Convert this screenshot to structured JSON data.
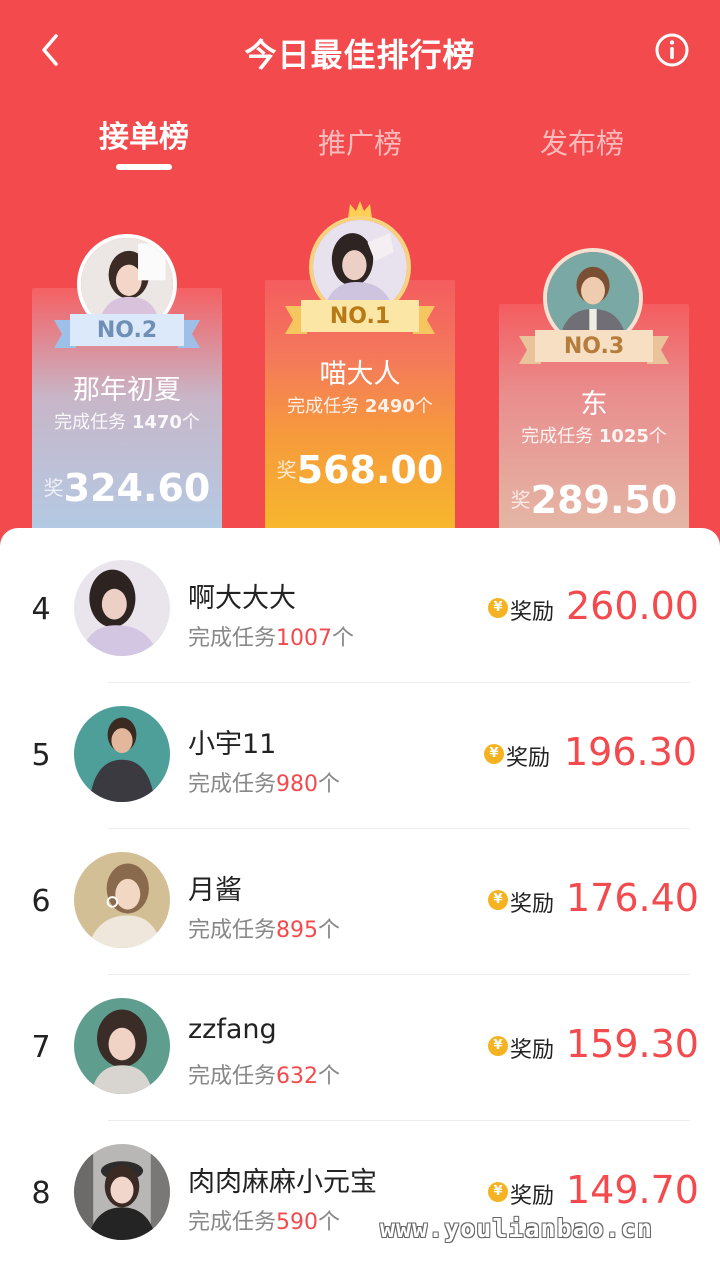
{
  "header": {
    "title": "今日最佳排行榜"
  },
  "tabs": [
    {
      "label": "接单榜"
    },
    {
      "label": "推广榜"
    },
    {
      "label": "发布榜"
    }
  ],
  "podium": {
    "second": {
      "badge": "NO.2",
      "name": "那年初夏",
      "tasks_prefix": "完成任务",
      "tasks": "1470",
      "tasks_suffix": "个",
      "reward_prefix": "奖",
      "reward": "324.60"
    },
    "first": {
      "badge": "NO.1",
      "name": "喵大人",
      "tasks_prefix": "完成任务",
      "tasks": "2490",
      "tasks_suffix": "个",
      "reward_prefix": "奖",
      "reward": "568.00"
    },
    "third": {
      "badge": "NO.3",
      "name": "东",
      "tasks_prefix": "完成任务",
      "tasks": "1025",
      "tasks_suffix": "个",
      "reward_prefix": "奖",
      "reward": "289.50"
    }
  },
  "list": [
    {
      "rank": "4",
      "name": "啊大大大",
      "tasks_prefix": "完成任务",
      "tasks": "1007",
      "tasks_suffix": "个",
      "reward_label": "奖励",
      "reward": "260.00"
    },
    {
      "rank": "5",
      "name": "小宇11",
      "tasks_prefix": "完成任务",
      "tasks": "980",
      "tasks_suffix": "个",
      "reward_label": "奖励",
      "reward": "196.30"
    },
    {
      "rank": "6",
      "name": "月酱",
      "tasks_prefix": "完成任务",
      "tasks": "895",
      "tasks_suffix": "个",
      "reward_label": "奖励",
      "reward": "176.40"
    },
    {
      "rank": "7",
      "name": "zzfang",
      "tasks_prefix": "完成任务",
      "tasks": "632",
      "tasks_suffix": "个",
      "reward_label": "奖励",
      "reward": "159.30"
    },
    {
      "rank": "8",
      "name": "肉肉麻麻小元宝",
      "tasks_prefix": "完成任务",
      "tasks": "590",
      "tasks_suffix": "个",
      "reward_label": "奖励",
      "reward": "149.70"
    }
  ],
  "coin_symbol": "¥",
  "watermark": "www.youlianbao.cn",
  "colors": {
    "brand": "#f34a4d",
    "gold": "#f5b321",
    "silver_card": "#b3cae4",
    "bronze_card": "#e4b7a6"
  },
  "icons": {
    "back": "chevron-left-icon",
    "info": "info-circle-icon",
    "crown": "crown-icon",
    "coin": "yuan-coin-icon"
  }
}
